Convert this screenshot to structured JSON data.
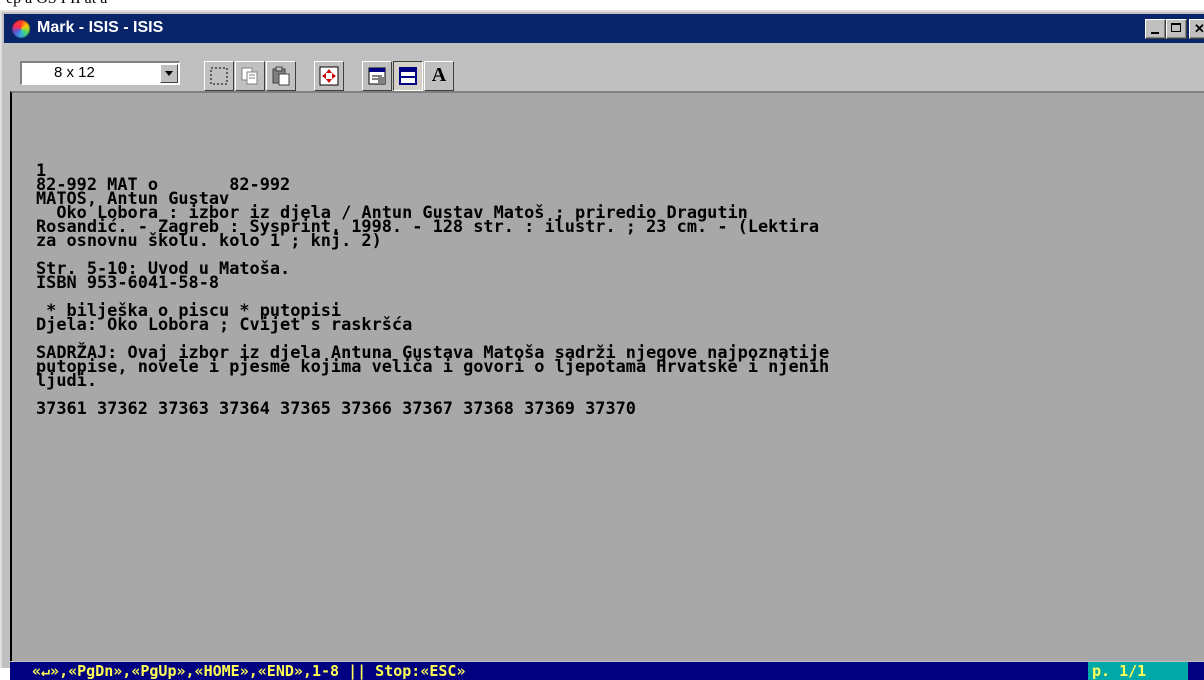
{
  "caption": "ep a OS I II at a",
  "window": {
    "title": "Mark - ISIS - ISIS"
  },
  "toolbar": {
    "font_size": "8 x 12",
    "tools": [
      "select-icon",
      "copy-icon",
      "paste-icon",
      "move-icon",
      "properties-icon",
      "window-icon",
      "font-icon"
    ],
    "font_button": "A"
  },
  "record": {
    "lines": [
      "1",
      "82-992 MAT o       82-992",
      "MATOŠ, Antun Gustav",
      "  Oko Lobora : izbor iz djela / Antun Gustav Matoš ; priredio Dragutin",
      "Rosandić. - Zagreb : Sysprint, 1998. - 128 str. : ilustr. ; 23 cm. - (Lektira",
      "za osnovnu školu. kolo 1 ; knj. 2)",
      "",
      "Str. 5-10: Uvod u Matoša.",
      "ISBN 953-6041-58-8",
      "",
      " * bilješka o piscu * putopisi",
      "Djela: Oko Lobora ; Cvijet s raskršća",
      "",
      "SADRŽAJ: Ovaj izbor iz djela Antuna Gustava Matoša sadrži njegove najpoznatije",
      "putopise, novele i pjesme kojima veliča i govori o ljepotama Hrvatske i njenih",
      "ljudi.",
      "",
      "37361 37362 37363 37364 37365 37366 37367 37368 37369 37370"
    ]
  },
  "status": {
    "keys": "«↵»,«PgDn»,«PgUp»,«HOME»,«END»,1-8 || Stop:«ESC»",
    "page": "p. 1/1"
  },
  "colors": {
    "titlebar": "#0a246a",
    "content_bg": "#a8a8a8",
    "status_bg": "#000080",
    "status_text": "#ffff55",
    "page_bg": "#00a8a8"
  }
}
